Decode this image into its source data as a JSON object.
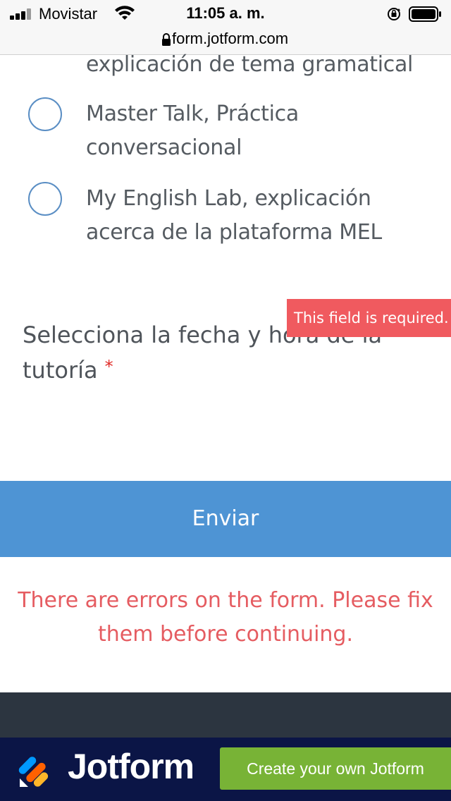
{
  "status_bar": {
    "carrier": "Movistar",
    "time": "11:05 a. m.",
    "icons": [
      "signal-icon",
      "wifi-icon",
      "rotation-lock-icon",
      "battery-icon"
    ]
  },
  "browser": {
    "url": "form.jotform.com",
    "icon": "lock-icon"
  },
  "options": {
    "partial_text": "explicación de tema gramatical",
    "items": [
      {
        "line1": "Master Talk, Práctica",
        "line2": "conversacional"
      },
      {
        "line1": "My English Lab, explicación",
        "line2": "acerca de la plataforma MEL"
      }
    ]
  },
  "question": {
    "line1": "Selecciona la fecha y hora de la",
    "line2": "tutoría",
    "required_mark": "*"
  },
  "error_tooltip": "This field is required.",
  "submit_label": "Enviar",
  "form_error": {
    "line1": "There are errors on the form. Please fix",
    "line2": "them before continuing."
  },
  "footer": {
    "brand": "Jotform",
    "cta": "Create your own Jotform"
  },
  "colors": {
    "accent_blue": "#4e94d4",
    "error_red": "#f05a5f",
    "cta_green": "#78b336",
    "footer_navy": "#0b1546"
  }
}
